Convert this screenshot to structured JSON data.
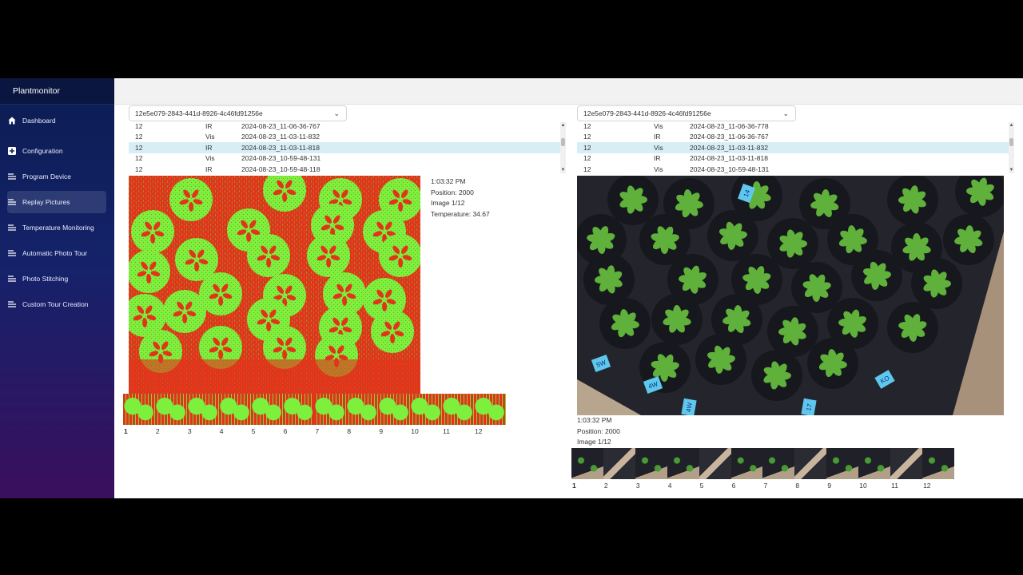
{
  "app": {
    "title": "Plantmonitor"
  },
  "sidebar": {
    "items": [
      {
        "label": "Dashboard",
        "icon": "home-icon",
        "active": false
      },
      {
        "label": "Configuration",
        "icon": "plus-square-icon",
        "active": false
      },
      {
        "label": "Program Device",
        "icon": "lines-icon",
        "active": false
      },
      {
        "label": "Replay Pictures",
        "icon": "lines-icon",
        "active": true
      },
      {
        "label": "Temperature Monitoring",
        "icon": "lines-icon",
        "active": false
      },
      {
        "label": "Automatic Photo Tour",
        "icon": "lines-icon",
        "active": false
      },
      {
        "label": "Photo Stitching",
        "icon": "lines-icon",
        "active": false
      },
      {
        "label": "Custom Tour Creation",
        "icon": "lines-icon",
        "active": false
      }
    ]
  },
  "left": {
    "select_value": "12e5e079-2843-441d-8926-4c46fd91256e",
    "rows": [
      {
        "id": "12",
        "type": "IR",
        "ts": "2024-08-23_11-06-36-767",
        "selected": false
      },
      {
        "id": "12",
        "type": "Vis",
        "ts": "2024-08-23_11-03-11-832",
        "selected": false
      },
      {
        "id": "12",
        "type": "IR",
        "ts": "2024-08-23_11-03-11-818",
        "selected": true
      },
      {
        "id": "12",
        "type": "Vis",
        "ts": "2024-08-23_10-59-48-131",
        "selected": false
      },
      {
        "id": "12",
        "type": "IR",
        "ts": "2024-08-23_10-59-48-118",
        "selected": false
      }
    ],
    "info": {
      "time": "1:03:32 PM",
      "position": "Position: 2000",
      "image": "Image 1/12",
      "temperature": "Temperature: 34.67"
    },
    "pages": [
      "1",
      "2",
      "3",
      "4",
      "5",
      "6",
      "7",
      "8",
      "9",
      "10",
      "11",
      "12"
    ],
    "current_page": "1"
  },
  "right": {
    "select_value": "12e5e079-2843-441d-8926-4c46fd91256e",
    "rows": [
      {
        "id": "12",
        "type": "Vis",
        "ts": "2024-08-23_11-06-36-778",
        "selected": false
      },
      {
        "id": "12",
        "type": "IR",
        "ts": "2024-08-23_11-06-36-767",
        "selected": false
      },
      {
        "id": "12",
        "type": "Vis",
        "ts": "2024-08-23_11-03-11-832",
        "selected": true
      },
      {
        "id": "12",
        "type": "IR",
        "ts": "2024-08-23_11-03-11-818",
        "selected": false
      },
      {
        "id": "12",
        "type": "Vis",
        "ts": "2024-08-23_10-59-48-131",
        "selected": false
      }
    ],
    "info": {
      "time": "1:03:32 PM",
      "position": "Position: 2000",
      "image": "Image 1/12"
    },
    "pages": [
      "1",
      "2",
      "3",
      "4",
      "5",
      "6",
      "7",
      "8",
      "9",
      "10",
      "11",
      "12"
    ],
    "current_page": "1",
    "tray_labels": [
      "14",
      "5W",
      "4W",
      "KO",
      "4W",
      "17"
    ]
  },
  "colors": {
    "sidebar_top": "#0b1d52",
    "sidebar_bottom": "#3a0f5e",
    "selected_row": "#d7eef7",
    "ir_hot": "#e2341b",
    "ir_plant": "#7cf03c",
    "vis_tray": "#1c1d24",
    "vis_plant": "#5fb13b"
  }
}
